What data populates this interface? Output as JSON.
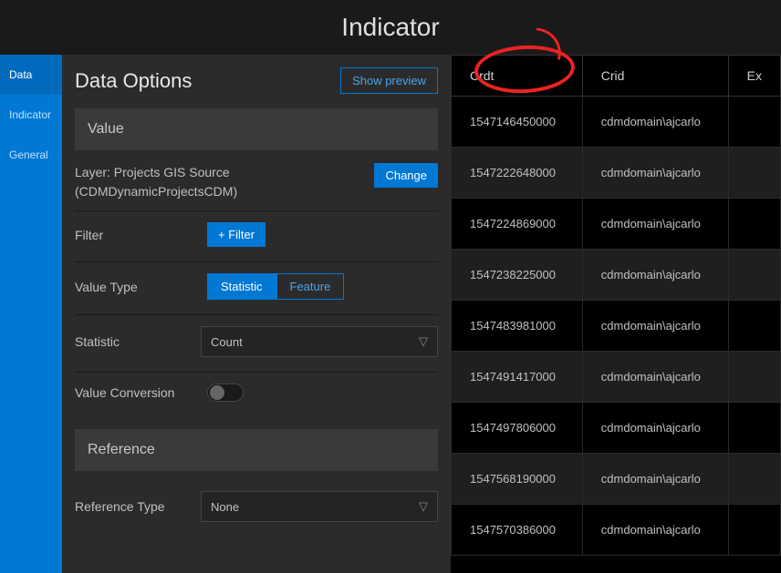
{
  "appTitle": "Indicator",
  "sidebar": {
    "items": [
      {
        "label": "Data"
      },
      {
        "label": "Indicator"
      },
      {
        "label": "General"
      }
    ]
  },
  "config": {
    "headerTitle": "Data Options",
    "previewBtn": "Show preview",
    "valueSection": "Value",
    "layerLabel": "Layer: Projects GIS Source (CDMDynamicProjectsCDM)",
    "changeBtn": "Change",
    "filterLabel": "Filter",
    "filterBtn": "+ Filter",
    "valueTypeLabel": "Value Type",
    "valueTypeOptions": {
      "statistic": "Statistic",
      "feature": "Feature"
    },
    "statisticLabel": "Statistic",
    "statisticValue": "Count",
    "valueConversionLabel": "Value Conversion",
    "referenceSection": "Reference",
    "referenceTypeLabel": "Reference Type",
    "referenceTypeValue": "None"
  },
  "table": {
    "headers": {
      "crdt": "Crdt",
      "crid": "Crid",
      "ex": "Ex"
    },
    "rows": [
      {
        "crdt": "1547146450000",
        "crid": "cdmdomain\\ajcarlo"
      },
      {
        "crdt": "1547222648000",
        "crid": "cdmdomain\\ajcarlo"
      },
      {
        "crdt": "1547224869000",
        "crid": "cdmdomain\\ajcarlo"
      },
      {
        "crdt": "1547238225000",
        "crid": "cdmdomain\\ajcarlo"
      },
      {
        "crdt": "1547483981000",
        "crid": "cdmdomain\\ajcarlo"
      },
      {
        "crdt": "1547491417000",
        "crid": "cdmdomain\\ajcarlo"
      },
      {
        "crdt": "1547497806000",
        "crid": "cdmdomain\\ajcarlo"
      },
      {
        "crdt": "1547568190000",
        "crid": "cdmdomain\\ajcarlo"
      },
      {
        "crdt": "1547570386000",
        "crid": "cdmdomain\\ajcarlo"
      }
    ]
  }
}
